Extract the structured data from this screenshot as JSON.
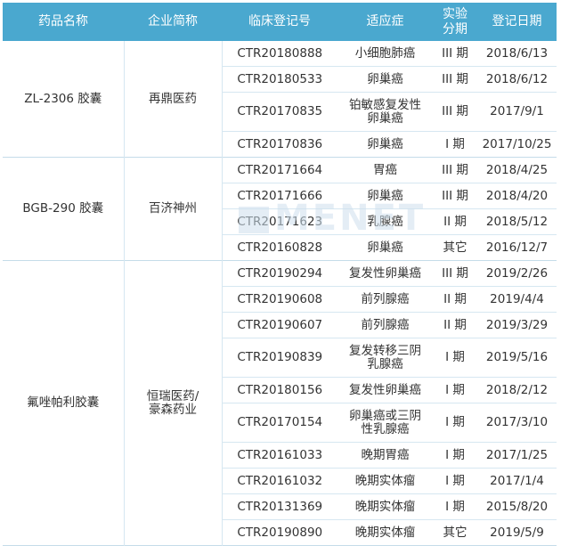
{
  "headers": [
    "药品名称",
    "企业简称",
    "临床登记号",
    "适应症",
    "实验\n分期",
    "登记日期"
  ],
  "groups": [
    {
      "drug": "ZL-2306 胶囊",
      "company": "再鼎医药",
      "rows": [
        {
          "reg": "CTR20180888",
          "ind": "小细胞肺癌",
          "phase": "III 期",
          "date": "2018/6/13"
        },
        {
          "reg": "CTR20180533",
          "ind": "卵巢癌",
          "phase": "III 期",
          "date": "2018/6/12"
        },
        {
          "reg": "CTR20170835",
          "ind": "铂敏感复发性\n卵巢癌",
          "phase": "III 期",
          "date": "2017/9/1"
        },
        {
          "reg": "CTR20170836",
          "ind": "卵巢癌",
          "phase": "I 期",
          "date": "2017/10/25"
        }
      ]
    },
    {
      "drug": "BGB-290 胶囊",
      "company": "百济神州",
      "rows": [
        {
          "reg": "CTR20171664",
          "ind": "胃癌",
          "phase": "III 期",
          "date": "2018/4/25"
        },
        {
          "reg": "CTR20171666",
          "ind": "卵巢癌",
          "phase": "III 期",
          "date": "2018/4/20"
        },
        {
          "reg": "CTR20171623",
          "ind": "乳腺癌",
          "phase": "II 期",
          "date": "2018/5/12"
        },
        {
          "reg": "CTR20160828",
          "ind": "卵巢癌",
          "phase": "其它",
          "date": "2016/12/7"
        }
      ]
    },
    {
      "drug": "氟唑帕利胶囊",
      "company": "恒瑞医药/\n豪森药业",
      "rows": [
        {
          "reg": "CTR20190294",
          "ind": "复发性卵巢癌",
          "phase": "III 期",
          "date": "2019/2/26"
        },
        {
          "reg": "CTR20190608",
          "ind": "前列腺癌",
          "phase": "II 期",
          "date": "2019/4/4"
        },
        {
          "reg": "CTR20190607",
          "ind": "前列腺癌",
          "phase": "II 期",
          "date": "2019/3/29"
        },
        {
          "reg": "CTR20190839",
          "ind": "复发转移三阴\n乳腺癌",
          "phase": "I 期",
          "date": "2019/5/16"
        },
        {
          "reg": "CTR20180156",
          "ind": "复发性卵巢癌",
          "phase": "I 期",
          "date": "2018/2/12"
        },
        {
          "reg": "CTR20170154",
          "ind": "卵巢癌或三阴\n性乳腺癌",
          "phase": "I 期",
          "date": "2017/3/10"
        },
        {
          "reg": "CTR20161033",
          "ind": "晚期胃癌",
          "phase": "I 期",
          "date": "2017/1/25"
        },
        {
          "reg": "CTR20161032",
          "ind": "晚期实体瘤",
          "phase": "I 期",
          "date": "2017/1/4"
        },
        {
          "reg": "CTR20131369",
          "ind": "晚期实体瘤",
          "phase": "I 期",
          "date": "2015/8/20"
        },
        {
          "reg": "CTR20190890",
          "ind": "晚期实体瘤",
          "phase": "其它",
          "date": "2019/5/9"
        }
      ]
    }
  ],
  "watermark": "MENET",
  "colors": {
    "header_bg": "#4aa8cf",
    "header_text": "#ffffff",
    "row_border": "#d6e7f1"
  }
}
